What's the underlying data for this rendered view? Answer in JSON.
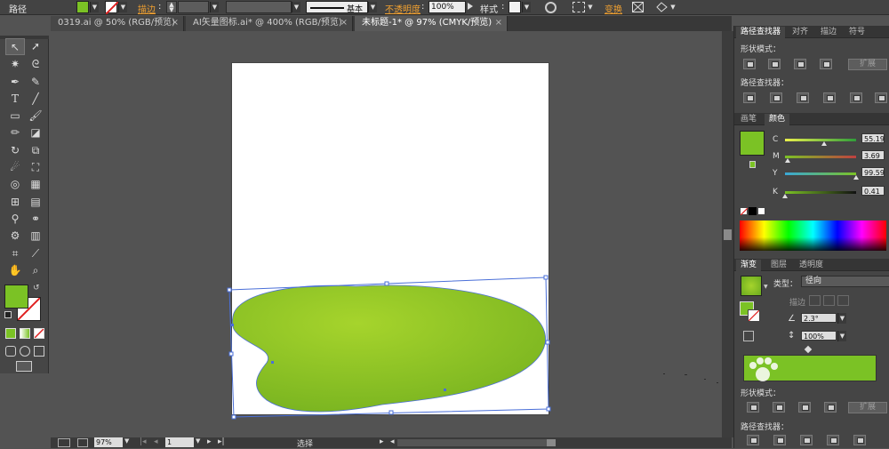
{
  "control_bar": {
    "object_type": "路径",
    "stroke_label": "描边",
    "stroke_style": "基本",
    "opacity_label": "不透明度",
    "opacity_value": "100%",
    "style_label": "样式",
    "transform_label": "变换"
  },
  "document_tabs": [
    {
      "title": "0319.ai @ 50% (RGB/预览)",
      "close": "×"
    },
    {
      "title": "AI矢量图标.ai* @ 400% (RGB/预览)",
      "close": "×"
    },
    {
      "title": "未标题-1* @ 97% (CMYK/预览)",
      "close": "×"
    }
  ],
  "status_bar": {
    "zoom": "97%",
    "page": "1",
    "tool_name": "选择"
  },
  "pathfinder_panel": {
    "tabs": [
      "路径查找器",
      "对齐",
      "描边",
      "符号"
    ],
    "shape_modes_label": "形状模式：",
    "pathfinders_label": "路径查找器：",
    "expand_label": "扩展"
  },
  "color_panel": {
    "tabs": [
      "画笔",
      "颜色"
    ],
    "channels": [
      {
        "name": "C",
        "value": "55.19",
        "level": 0.552
      },
      {
        "name": "M",
        "value": "3.69",
        "level": 0.037
      },
      {
        "name": "Y",
        "value": "99.59",
        "level": 0.996
      },
      {
        "name": "K",
        "value": "0.41",
        "level": 0.004
      }
    ],
    "fill_color": "#7bc225"
  },
  "gradient_panel": {
    "tabs": [
      "渐变",
      "图层",
      "透明度"
    ],
    "type_label": "类型：",
    "type_value": "径向",
    "stroke_label": "描边",
    "angle_value": "2.3°",
    "aspect_value": "100%",
    "shape_modes_label": "形状模式：",
    "pathfinders_label": "路径查找器：",
    "expand_label": "扩展"
  },
  "colors": {
    "accent_orange": "#f0a030",
    "shape_green_light": "#a6d42c",
    "shape_green_dark": "#7cb621",
    "selection_blue": "#4a6fd8"
  }
}
